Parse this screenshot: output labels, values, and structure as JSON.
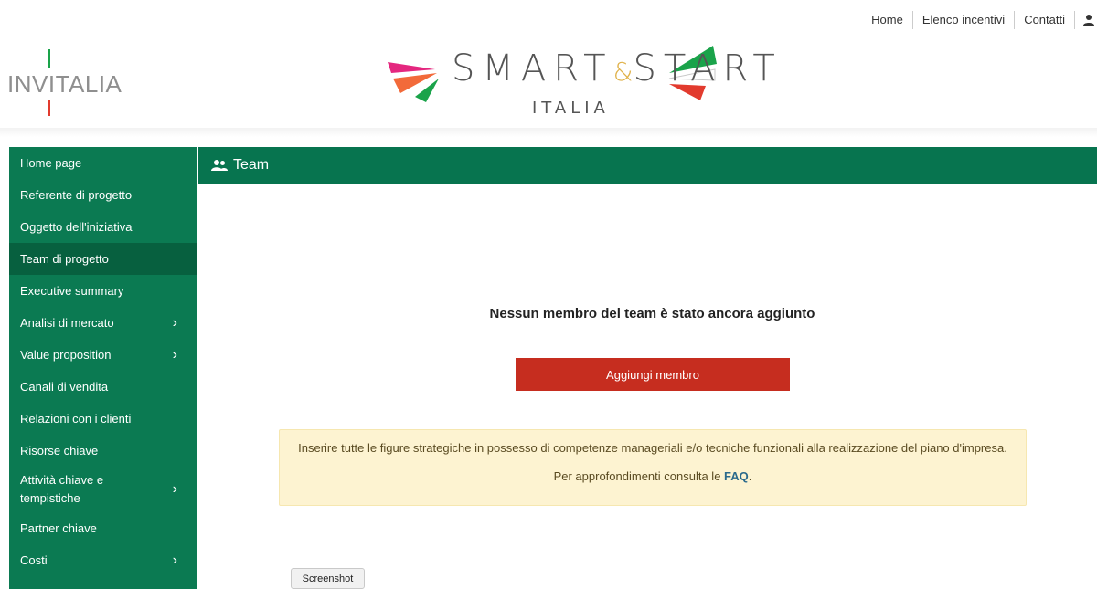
{
  "topnav": {
    "home": "Home",
    "incentives": "Elenco incentivi",
    "contacts": "Contatti"
  },
  "header": {
    "invitalia_logo": "INVITALIA",
    "smart_start_word_a": "SMART",
    "smart_start_amp": "&",
    "smart_start_word_b": "START",
    "smart_start_sub": "ITALIA"
  },
  "sidebar": {
    "items": [
      {
        "label": "Home page",
        "has_children": false
      },
      {
        "label": "Referente di progetto",
        "has_children": false
      },
      {
        "label": "Oggetto dell'iniziativa",
        "has_children": false
      },
      {
        "label": "Team di progetto",
        "has_children": false,
        "active": true
      },
      {
        "label": "Executive summary",
        "has_children": false
      },
      {
        "label": "Analisi di mercato",
        "has_children": true
      },
      {
        "label": "Value proposition",
        "has_children": true
      },
      {
        "label": "Canali di vendita",
        "has_children": false
      },
      {
        "label": "Relazioni con i clienti",
        "has_children": false
      },
      {
        "label": "Risorse chiave",
        "has_children": false
      },
      {
        "label": "Attività chiave e tempistiche",
        "has_children": true
      },
      {
        "label": "Partner chiave",
        "has_children": false
      },
      {
        "label": "Costi",
        "has_children": true
      }
    ]
  },
  "panel": {
    "title": "Team",
    "icon": "team-icon",
    "empty_message": "Nessun membro del team è stato ancora aggiunto",
    "add_button": "Aggiungi membro"
  },
  "info": {
    "line1": "Inserire tutte le figure strategiche in possesso di competenze manageriali e/o tecniche funzionali alla realizzazione del piano d'impresa.",
    "line2_prefix": "Per approfondimenti consulta le ",
    "faq_link": "FAQ",
    "line2_suffix": "."
  },
  "screenshot_button": "Screenshot",
  "colors": {
    "sidebar_bg": "#0b7a52",
    "sidebar_active": "#07603f",
    "panel_header": "#07744f",
    "primary_button": "#c62d1f",
    "info_bg": "#fdf3d1",
    "link": "#2b6a8c"
  }
}
